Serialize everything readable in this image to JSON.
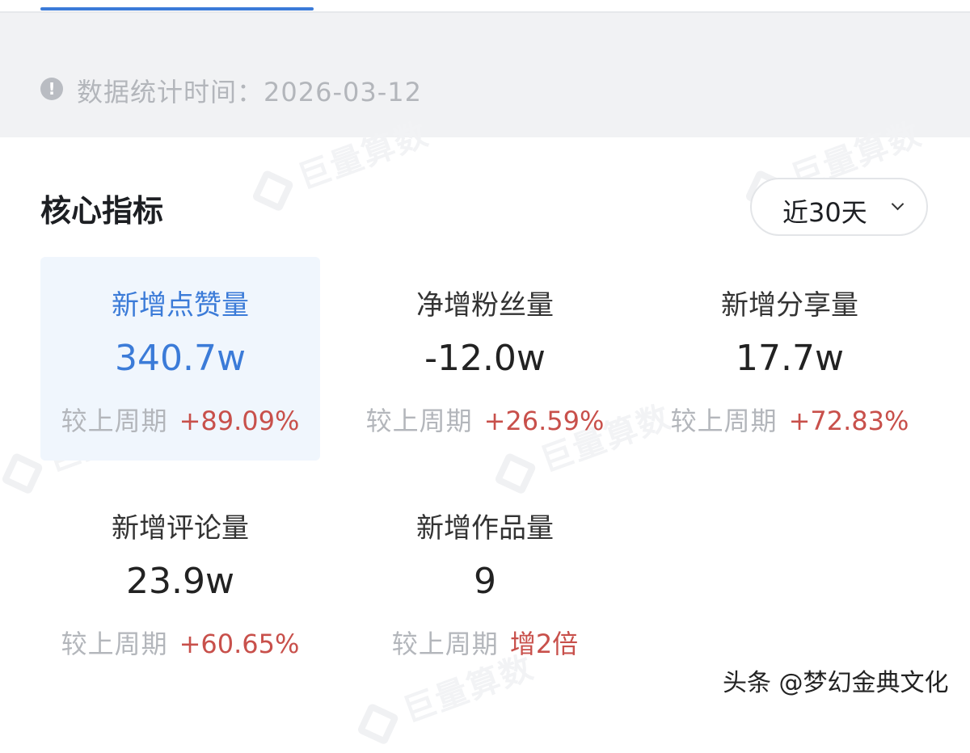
{
  "notice": {
    "icon": "info-icon",
    "text": "数据统计时间：2026-03-12"
  },
  "watermark": "巨量算数",
  "section": {
    "title": "核心指标",
    "range": {
      "selected": "近30天",
      "icon": "chevron-down-icon"
    }
  },
  "metrics": [
    {
      "label": "新增点赞量",
      "value": "340.7w",
      "compare_label": "较上周期",
      "change": "+89.09%",
      "selected": true
    },
    {
      "label": "净增粉丝量",
      "value": "-12.0w",
      "compare_label": "较上周期",
      "change": "+26.59%"
    },
    {
      "label": "新增分享量",
      "value": "17.7w",
      "compare_label": "较上周期",
      "change": "+72.83%"
    },
    {
      "label": "新增评论量",
      "value": "23.9w",
      "compare_label": "较上周期",
      "change": "+60.65%"
    },
    {
      "label": "新增作品量",
      "value": "9",
      "compare_label": "较上周期",
      "change": "增2倍"
    }
  ],
  "credit": "头条 @梦幻金典文化",
  "colors": {
    "accent": "#3b7bd8",
    "increase": "#c8504b",
    "muted": "#b3b6bb",
    "selected_bg": "#f0f6fd"
  }
}
